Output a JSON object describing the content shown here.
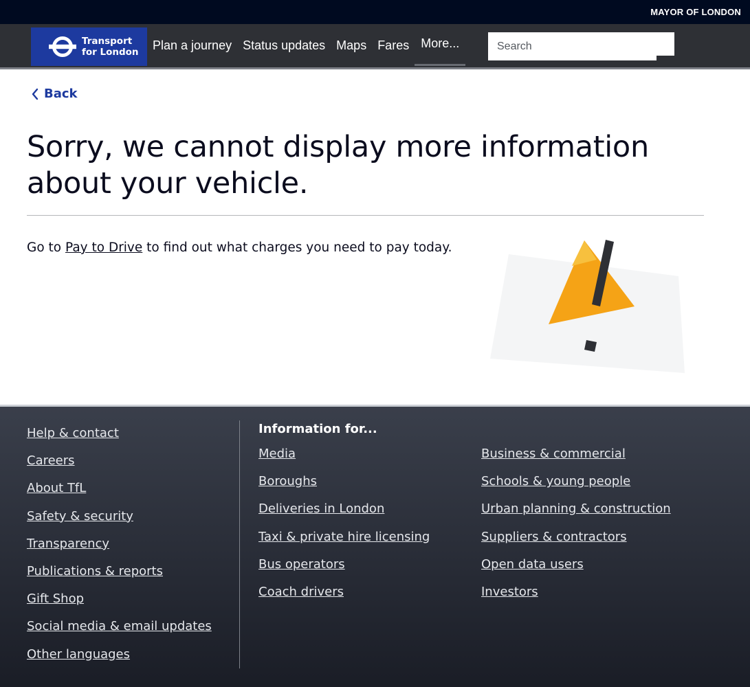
{
  "top": {
    "mayor_label": "MAYOR OF LONDON"
  },
  "header": {
    "logo_line1": "Transport",
    "logo_line2": "for London",
    "nav": [
      {
        "label": "Plan a journey"
      },
      {
        "label": "Status updates"
      },
      {
        "label": "Maps"
      },
      {
        "label": "Fares"
      },
      {
        "label": "More..."
      }
    ],
    "search": {
      "placeholder": "Search",
      "value": ""
    }
  },
  "main": {
    "back_label": "Back",
    "title": "Sorry, we cannot display more information about your vehicle.",
    "info_prefix": "Go to ",
    "info_link": "Pay to Drive",
    "info_suffix": " to find out what charges you need to pay today."
  },
  "footer": {
    "col1": [
      "Help & contact",
      "Careers",
      "About TfL",
      "Safety & security",
      "Transparency",
      "Publications & reports",
      "Gift Shop",
      "Social media & email updates",
      "Other languages"
    ],
    "information_heading": "Information for...",
    "col2": [
      "Media",
      "Boroughs",
      "Deliveries in London",
      "Taxi & private hire licensing",
      "Bus operators",
      "Coach drivers"
    ],
    "col3": [
      "Business & commercial",
      "Schools & young people",
      "Urban planning & construction",
      "Suppliers & contractors",
      "Open data users",
      "Investors"
    ]
  },
  "colors": {
    "brand_blue": "#1d3a9f",
    "nav_bg": "#2e3035",
    "warning_orange": "#f5a316"
  }
}
